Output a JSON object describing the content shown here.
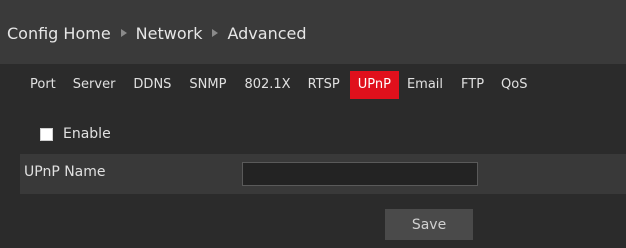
{
  "breadcrumb": [
    "Config Home",
    "Network",
    "Advanced"
  ],
  "tabs": [
    "Port",
    "Server",
    "DDNS",
    "SNMP",
    "802.1X",
    "RTSP",
    "UPnP",
    "Email",
    "FTP",
    "QoS"
  ],
  "active_tab": "UPnP",
  "form": {
    "enable_label": "Enable",
    "enable_checked": false,
    "name_label": "UPnP Name",
    "name_value": ""
  },
  "save_label": "Save",
  "colors": {
    "background": "#2b2b2b",
    "header": "#3a3a3a",
    "active_tab": "#e0101c",
    "row": "#393939",
    "button": "#4a4a4a"
  }
}
